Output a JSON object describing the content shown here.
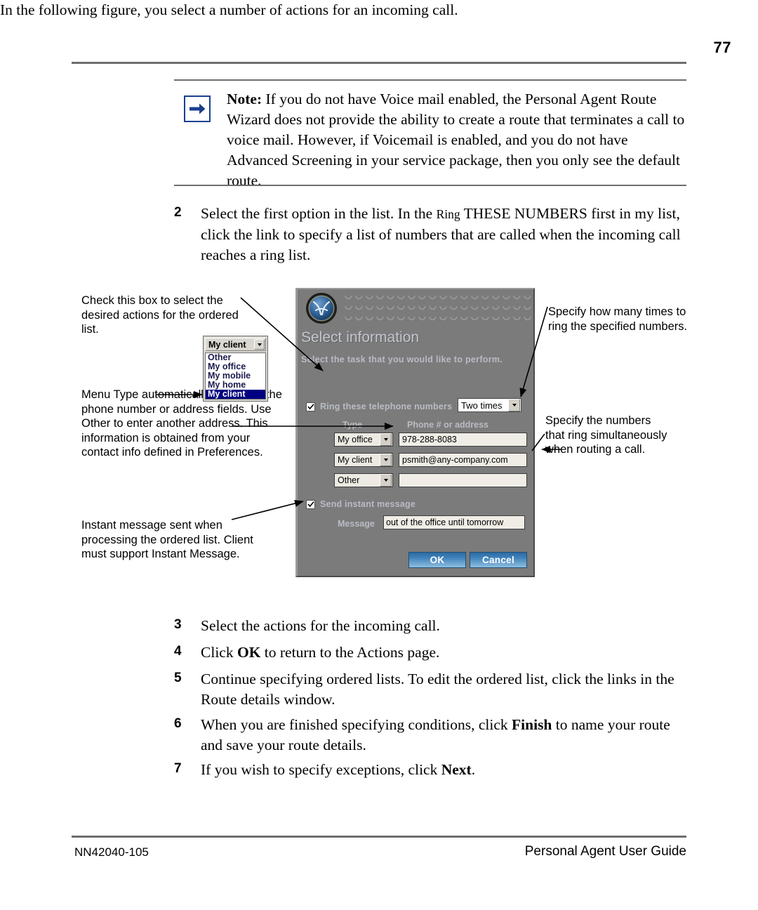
{
  "page": {
    "number": "77"
  },
  "note": {
    "lead": "Note:",
    "text": " If you do not have Voice mail enabled, the Personal Agent Route Wizard does not provide the ability to create a route that terminates a call to voice mail. However, if Voicemail is enabled, and you do not have Advanced Screening in your service package, then you only see the default route.",
    "icon": "right-arrow-icon"
  },
  "steps": [
    {
      "num": "2",
      "html": "Select the first option in the list. In the <span class=\"smallcaps\">Ring</span> THESE NUMBERS first in my list, click the link to specify a list of numbers that are called when the incoming call reaches a ring list."
    },
    {
      "num": "3",
      "html": "Select the actions for the incoming call."
    },
    {
      "num": "4",
      "html": "Click <b>OK</b> to return to the Actions page."
    },
    {
      "num": "5",
      "html": "Continue specifying ordered lists. To edit the ordered list, click the links in the Route details window."
    },
    {
      "num": "6",
      "html": "When you are finished specifying conditions, click <b>Finish</b> to name your route and save your route details."
    },
    {
      "num": "7",
      "html": "If you wish to specify exceptions, click <b>Next</b>."
    }
  ],
  "step2_subtext": "In the following figure, you select a number of actions for an incoming call.",
  "figure": {
    "callouts": {
      "check_box": "Check this box to select the desired actions for the ordered list.",
      "menu_type": "Menu Type automatically populates the phone number or address fields. Use Other to enter another address. This information is obtained from your contact info defined in Preferences.",
      "instant_message": "Instant message sent when processing the ordered list. Client must support Instant Message.",
      "ring_times": "Specify how many times to ring the specified numbers.",
      "simultaneous": "Specify the numbers that ring simultaneously when routing a call."
    },
    "type_list": {
      "selected": "My client",
      "options": [
        "Other",
        "My office",
        "My mobile",
        "My home",
        "My client"
      ]
    },
    "dialog": {
      "logo": "nortel-globemark-logo",
      "title": "Select information",
      "subtitle": "Select the task that you would like to perform.",
      "ring_checkbox": {
        "label": "Ring these telephone numbers",
        "checked": true
      },
      "times_select": {
        "value": "Two times"
      },
      "columns": {
        "type": "Type",
        "phone": "Phone # or address"
      },
      "rows": [
        {
          "type": "My office",
          "value": "978-288-8083"
        },
        {
          "type": "My client",
          "value": "psmith@any-company.com"
        },
        {
          "type": "Other",
          "value": ""
        }
      ],
      "im_checkbox": {
        "label": "Send instant message",
        "checked": true
      },
      "message_label": "Message",
      "message_value": "out of the office until tomorrow",
      "buttons": {
        "ok": "OK",
        "cancel": "Cancel"
      }
    }
  },
  "footer": {
    "left": "NN42040-105",
    "right": "Personal Agent User Guide"
  },
  "colors": {
    "rule": "#6e6e6e",
    "note_icon_border": "#1b3f8f",
    "dialog_bg": "#7b7b7b",
    "dialog_label": "#b9bcc4",
    "button_blue": "#3f82bb",
    "list_highlight": "#000080"
  }
}
